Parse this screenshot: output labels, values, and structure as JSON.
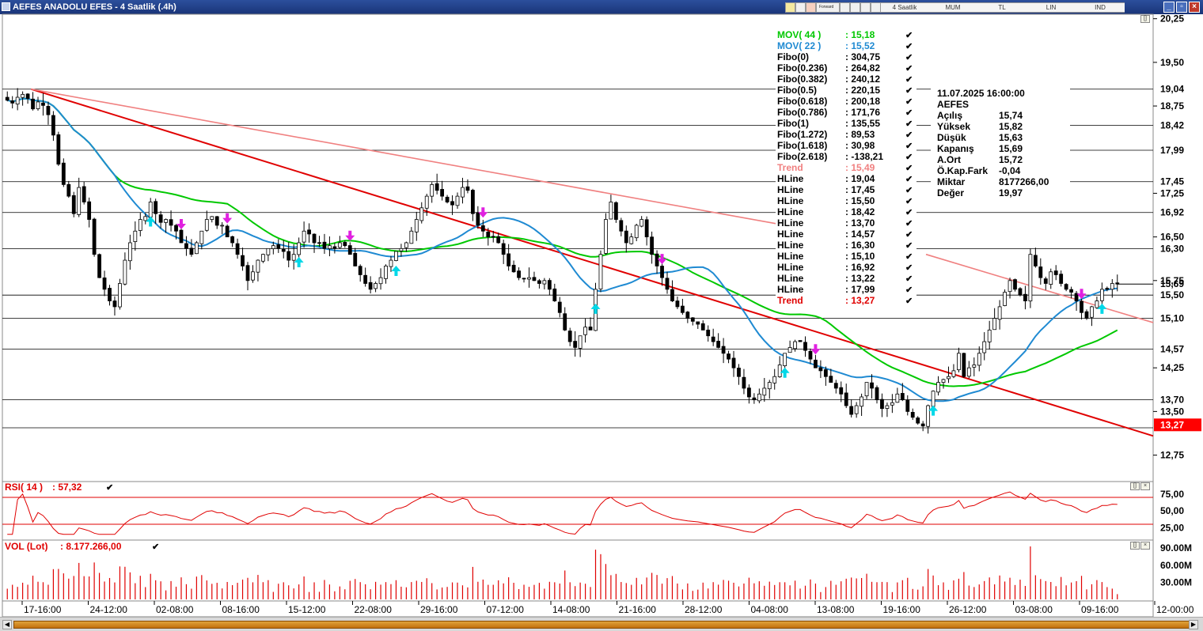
{
  "window": {
    "title": "AEFES ANADOLU EFES - 4 Saatlik (.4h)",
    "toolbar_labels": [
      "Forward",
      "4 Saatlik",
      "MUM",
      "TL",
      "LIN",
      "IND"
    ]
  },
  "colors": {
    "mov44": "#00c800",
    "mov22": "#1f8ad2",
    "trend": "#e00000",
    "trend_light": "#f08080",
    "hline": "#000000",
    "up_arrow": "#00d8e8",
    "down_arrow": "#e020e0",
    "rsi": "#e00000",
    "vol": "#e00000"
  },
  "legend": {
    "rows": [
      {
        "label": "MOV( 44 )",
        "value": ": 15,18",
        "color": "#00c800"
      },
      {
        "label": "MOV( 22 )",
        "value": ": 15,52",
        "color": "#1f8ad2"
      },
      {
        "label": "Fibo(0)",
        "value": ": 304,75",
        "color": "#000000"
      },
      {
        "label": "Fibo(0.236)",
        "value": ": 264,82",
        "color": "#000000"
      },
      {
        "label": "Fibo(0.382)",
        "value": ": 240,12",
        "color": "#000000"
      },
      {
        "label": "Fibo(0.5)",
        "value": ": 220,15",
        "color": "#000000"
      },
      {
        "label": "Fibo(0.618)",
        "value": ": 200,18",
        "color": "#000000"
      },
      {
        "label": "Fibo(0.786)",
        "value": ": 171,76",
        "color": "#000000"
      },
      {
        "label": "Fibo(1)",
        "value": ": 135,55",
        "color": "#000000"
      },
      {
        "label": "Fibo(1.272)",
        "value": ": 89,53",
        "color": "#000000"
      },
      {
        "label": "Fibo(1.618)",
        "value": ": 30,98",
        "color": "#000000"
      },
      {
        "label": "Fibo(2.618)",
        "value": ": -138,21",
        "color": "#000000"
      },
      {
        "label": "Trend",
        "value": ": 15,49",
        "color": "#f08080"
      },
      {
        "label": "HLine",
        "value": ": 19,04",
        "color": "#000000"
      },
      {
        "label": "HLine",
        "value": ": 17,45",
        "color": "#000000"
      },
      {
        "label": "HLine",
        "value": ": 15,50",
        "color": "#000000"
      },
      {
        "label": "HLine",
        "value": ": 18,42",
        "color": "#000000"
      },
      {
        "label": "HLine",
        "value": ": 13,70",
        "color": "#000000"
      },
      {
        "label": "HLine",
        "value": ": 14,57",
        "color": "#000000"
      },
      {
        "label": "HLine",
        "value": ": 16,30",
        "color": "#000000"
      },
      {
        "label": "HLine",
        "value": ": 15,10",
        "color": "#000000"
      },
      {
        "label": "HLine",
        "value": ": 16,92",
        "color": "#000000"
      },
      {
        "label": "HLine",
        "value": ": 13,22",
        "color": "#000000"
      },
      {
        "label": "HLine",
        "value": ": 17,99",
        "color": "#000000"
      },
      {
        "label": "Trend",
        "value": ": 13,27",
        "color": "#e00000"
      }
    ]
  },
  "info_box": {
    "datetime": "11.07.2025   16:00:00",
    "symbol": "AEFES",
    "rows": [
      {
        "k": "Açılış",
        "v": "15,74"
      },
      {
        "k": "Yüksek",
        "v": "15,82"
      },
      {
        "k": "Düşük",
        "v": "15,63"
      },
      {
        "k": "Kapanış",
        "v": "15,69"
      },
      {
        "k": "A.Ort",
        "v": "15,72"
      },
      {
        "k": "Ö.Kap.Fark",
        "v": "-0,04"
      },
      {
        "k": "Miktar",
        "v": "8177266,00"
      },
      {
        "k": "Değer",
        "v": "19,97"
      }
    ]
  },
  "rsi_panel": {
    "label": "RSI( 14 )",
    "value": ": 57,32"
  },
  "vol_panel": {
    "label": "VOL (Lot)",
    "value": ": 8.177.266,00"
  },
  "chart_data": [
    {
      "type": "candlestick",
      "title": "AEFES ANADOLU EFES - 4 Saatlik (.4h)",
      "x_tick_labels": [
        "17-16:00",
        "24-12:00",
        "02-08:00",
        "08-16:00",
        "15-12:00",
        "22-08:00",
        "29-16:00",
        "07-12:00",
        "14-08:00",
        "21-16:00",
        "28-12:00",
        "04-08:00",
        "13-08:00",
        "19-16:00",
        "26-12:00",
        "03-08:00",
        "09-16:00",
        "12-00:00"
      ],
      "y_tick_labels": [
        "20,25",
        "19,50",
        "18,75",
        "17,25",
        "16,50",
        "15,75",
        "14,25",
        "13,50",
        "12,75"
      ],
      "ylim": [
        12.35,
        20.3
      ],
      "hlines": [
        19.04,
        18.42,
        17.99,
        17.45,
        16.92,
        16.3,
        15.5,
        15.1,
        14.57,
        13.7,
        13.22
      ],
      "hline_labels": [
        "19,04",
        "18,42",
        "17,99",
        "17,45",
        "16,92",
        "16,30",
        "15,50",
        "15,10",
        "14,57",
        "13,70",
        "13,27"
      ],
      "last_price": {
        "value": 15.69,
        "label": "15,69"
      },
      "trend_red": {
        "from": [
          2,
          19.04
        ],
        "to": [
          172,
          13.27
        ],
        "value_label": "13,27"
      },
      "trend_light": {
        "from": [
          2,
          19.04
        ],
        "to": [
          116,
          16.72
        ]
      },
      "trend_light2": {
        "from": [
          138,
          16.2
        ],
        "to": [
          172,
          15.3
        ]
      },
      "closes": [
        18.85,
        18.8,
        18.9,
        18.95,
        18.88,
        18.7,
        18.82,
        18.76,
        18.6,
        18.25,
        17.75,
        17.4,
        17.2,
        16.9,
        17.35,
        17.1,
        16.8,
        16.2,
        15.8,
        15.6,
        15.4,
        15.3,
        15.7,
        16.1,
        16.4,
        16.6,
        16.8,
        16.85,
        17.1,
        16.9,
        16.75,
        16.8,
        16.7,
        16.6,
        16.4,
        16.3,
        16.2,
        16.4,
        16.6,
        16.8,
        16.85,
        16.7,
        16.7,
        16.5,
        16.4,
        16.2,
        16.0,
        15.75,
        15.9,
        16.1,
        16.2,
        16.3,
        16.35,
        16.3,
        16.25,
        16.1,
        16.2,
        16.4,
        16.6,
        16.55,
        16.4,
        16.4,
        16.3,
        16.35,
        16.3,
        16.4,
        16.35,
        16.2,
        16.0,
        15.85,
        15.7,
        15.6,
        15.7,
        15.8,
        16.0,
        16.1,
        16.25,
        16.3,
        16.4,
        16.6,
        16.8,
        17.0,
        17.2,
        17.4,
        17.3,
        17.2,
        17.1,
        17.05,
        17.2,
        17.35,
        17.3,
        16.9,
        16.7,
        16.6,
        16.5,
        16.5,
        16.4,
        16.2,
        16.0,
        15.9,
        15.8,
        15.78,
        15.8,
        15.75,
        15.7,
        15.75,
        15.6,
        15.4,
        15.2,
        14.9,
        14.7,
        14.6,
        14.8,
        14.95,
        14.9,
        15.6,
        16.2,
        16.8,
        17.1,
        16.8,
        16.6,
        16.4,
        16.5,
        16.7,
        16.8,
        16.5,
        16.2,
        16.0,
        15.8,
        15.6,
        15.4,
        15.3,
        15.2,
        15.1,
        15.05,
        15.0,
        14.9,
        14.8,
        14.7,
        14.6,
        14.5,
        14.4,
        14.25,
        14.1,
        13.9,
        13.75,
        13.7,
        13.8,
        13.9,
        14.0,
        14.1,
        14.3,
        14.5,
        14.6,
        14.7,
        14.7,
        14.55,
        14.4,
        14.25,
        14.2,
        14.1,
        14.0,
        13.9,
        13.8,
        13.6,
        13.45,
        13.6,
        13.75,
        14.0,
        13.9,
        13.7,
        13.55,
        13.6,
        13.65,
        13.8,
        13.7,
        13.5,
        13.4,
        13.3,
        13.25,
        13.6,
        13.85,
        14.0,
        14.05,
        14.1,
        14.2,
        14.5,
        14.1,
        14.25,
        14.3,
        14.5,
        14.7,
        14.9,
        15.1,
        15.3,
        15.55,
        15.75,
        15.6,
        15.5,
        15.4,
        16.2,
        16.0,
        15.8,
        15.7,
        15.9,
        15.85,
        15.7,
        15.6,
        15.55,
        15.4,
        15.2,
        15.1,
        15.3,
        15.4,
        15.6,
        15.6,
        15.7,
        15.69
      ]
    },
    {
      "type": "line",
      "name": "RSI( 14 )",
      "y_tick_labels": [
        "75,00",
        "50,00",
        "25,00"
      ],
      "ylim": [
        10,
        90
      ],
      "levels": [
        70,
        30
      ],
      "current": 57.32
    },
    {
      "type": "bar",
      "name": "VOL (Lot)",
      "y_tick_labels": [
        "90.00M",
        "60.00M",
        "30.00M"
      ],
      "ylim": [
        0,
        100
      ],
      "current": 8.18
    }
  ]
}
